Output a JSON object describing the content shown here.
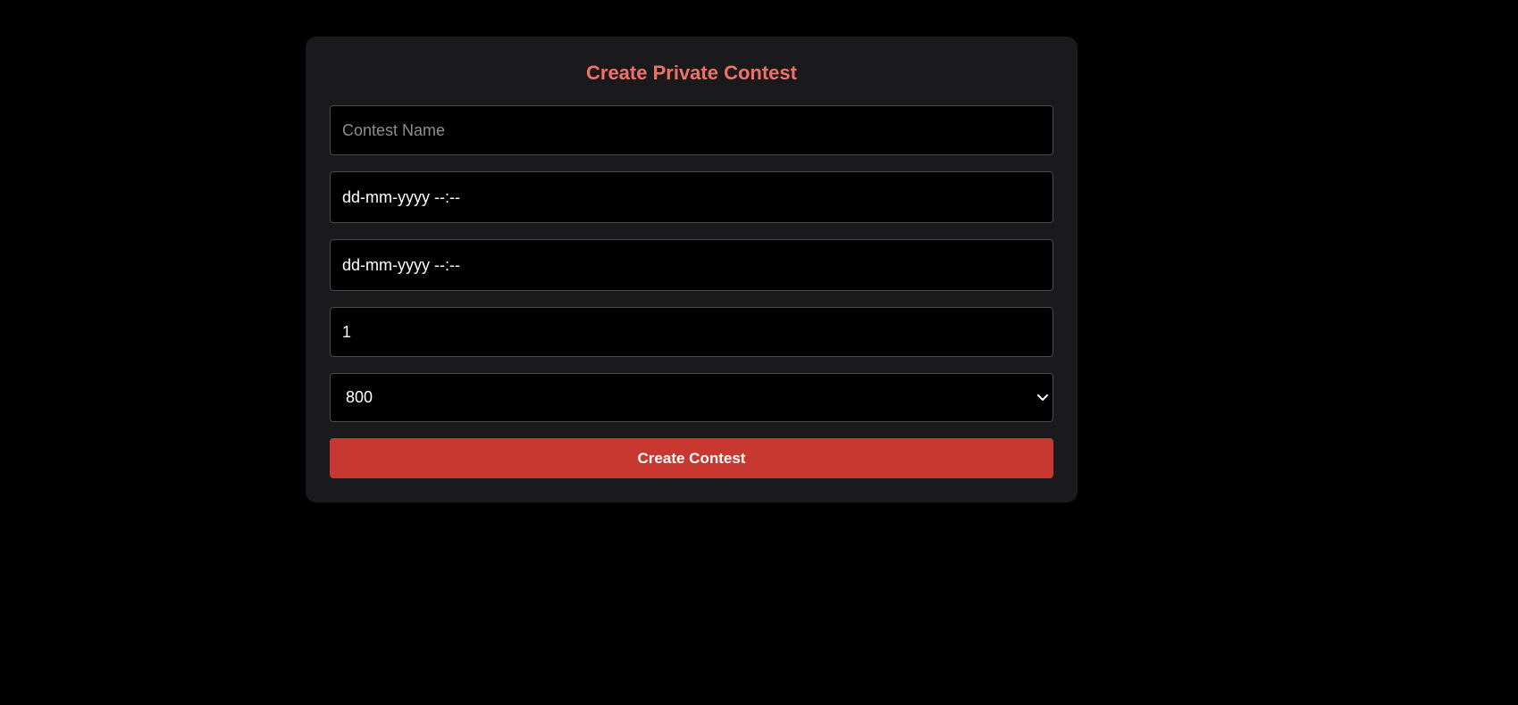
{
  "form": {
    "title": "Create Private Contest",
    "contest_name_placeholder": "Contest Name",
    "start_time_value": "dd-mm-yyyy --:--",
    "end_time_value": "dd-mm-yyyy --:--",
    "number_value": "1",
    "rating_selected": "800",
    "submit_label": "Create Contest"
  },
  "colors": {
    "background": "#000000",
    "card": "#1a1a1c",
    "title": "#f07168",
    "button": "#c83830"
  },
  "icons": {
    "dropdown": "chevron-down-icon"
  }
}
